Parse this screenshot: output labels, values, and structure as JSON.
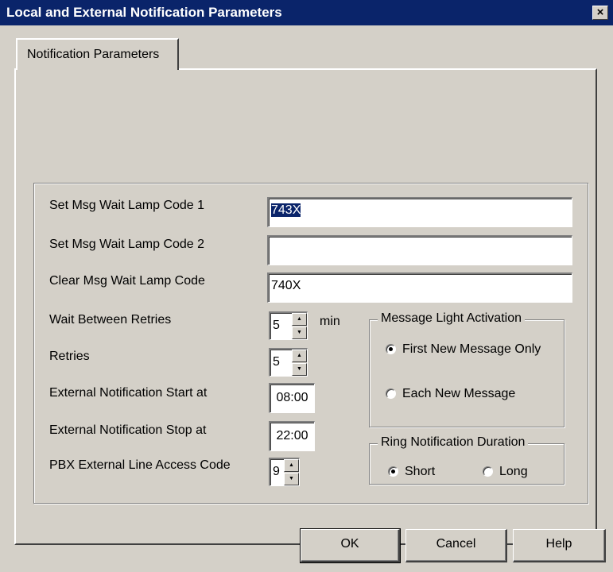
{
  "window": {
    "title": "Local and External Notification Parameters",
    "close_glyph": "×",
    "close_icon": "close-icon"
  },
  "tabs": [
    {
      "label": "Notification Parameters",
      "selected": true
    }
  ],
  "fields": {
    "set_msg_wait_lamp_code_1": {
      "label": "Set Msg Wait Lamp Code 1",
      "value": "743X"
    },
    "set_msg_wait_lamp_code_2": {
      "label": "Set Msg Wait Lamp Code 2",
      "value": ""
    },
    "clear_msg_wait_lamp_code": {
      "label": "Clear Msg Wait Lamp Code",
      "value": "740X"
    },
    "wait_between_retries": {
      "label": "Wait Between Retries",
      "value": "5",
      "unit": "min"
    },
    "retries": {
      "label": "Retries",
      "value": "5"
    },
    "external_notification_start": {
      "label": "External Notification Start at",
      "value": "08:00"
    },
    "external_notification_stop": {
      "label": "External Notification Stop at",
      "value": "22:00"
    },
    "pbx_external_line_access_code": {
      "label": "PBX External Line Access Code",
      "value": "9"
    }
  },
  "message_light_activation": {
    "legend": "Message Light Activation",
    "options": [
      {
        "label": "First New Message Only",
        "checked": true
      },
      {
        "label": "Each New Message",
        "checked": false
      }
    ]
  },
  "ring_notification_duration": {
    "legend": "Ring Notification Duration",
    "options": [
      {
        "label": "Short",
        "checked": true
      },
      {
        "label": "Long",
        "checked": false
      }
    ]
  },
  "spinner": {
    "up_glyph": "▲",
    "down_glyph": "▼"
  },
  "buttons": {
    "ok": "OK",
    "cancel": "Cancel",
    "help": "Help"
  },
  "colors": {
    "titlebar": "#0a246a",
    "face": "#d4d0c8",
    "selection": "#0a246a"
  }
}
